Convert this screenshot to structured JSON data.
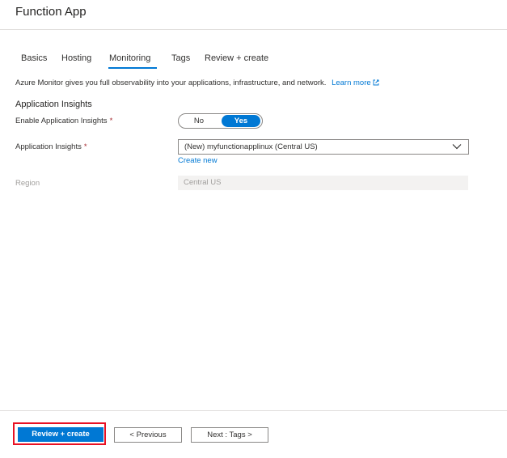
{
  "header": {
    "title": "Function App"
  },
  "tabs": [
    {
      "label": "Basics"
    },
    {
      "label": "Hosting"
    },
    {
      "label": "Monitoring",
      "active": true
    },
    {
      "label": "Tags"
    },
    {
      "label": "Review + create"
    }
  ],
  "monitoring": {
    "description": "Azure Monitor gives you full observability into your applications, infrastructure, and network.",
    "learn_more": "Learn more",
    "section_title": "Application Insights",
    "enable_label": "Enable Application Insights",
    "required_mark": "*",
    "toggle": {
      "off_label": "No",
      "on_label": "Yes",
      "selected": "Yes"
    },
    "app_insights_label": "Application Insights",
    "app_insights_value": "(New) myfunctionapplinux (Central US)",
    "create_new": "Create new",
    "region_label": "Region",
    "region_value": "Central US"
  },
  "footer": {
    "review_create": "Review + create",
    "previous": "< Previous",
    "next": "Next : Tags >"
  },
  "colors": {
    "accent": "#0078d4",
    "highlight": "#e81123",
    "required": "#a4262c"
  }
}
